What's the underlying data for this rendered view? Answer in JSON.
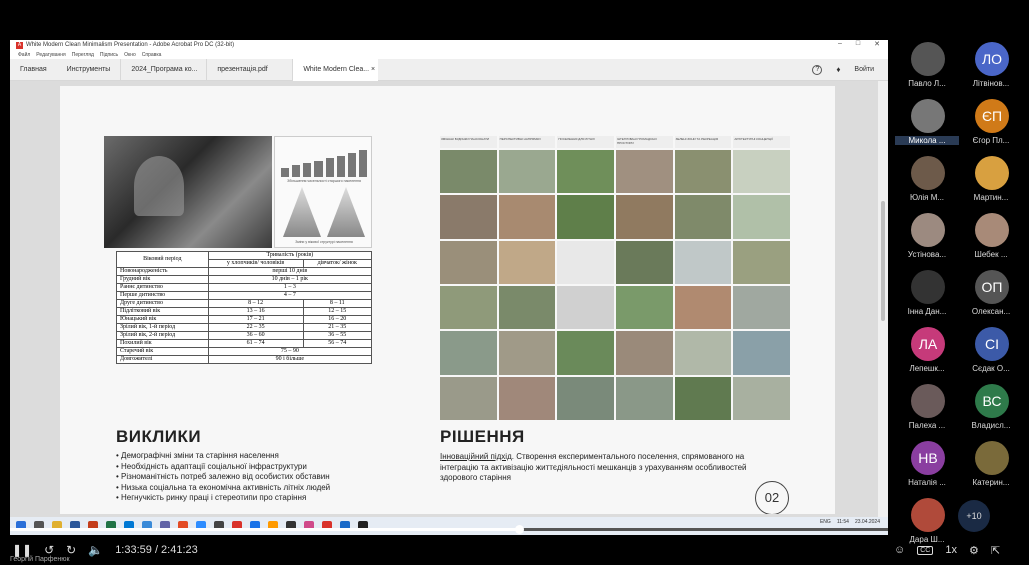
{
  "caption": "",
  "window": {
    "title": "White Modern Clean Minimalism Presentation - Adobe Acrobat Pro DC (32-bit)",
    "controls": [
      "–",
      "□",
      "✕"
    ],
    "menu": [
      "Файл",
      "Редагування",
      "Перегляд",
      "Підпись",
      "Окно",
      "Справка"
    ]
  },
  "tabs": {
    "home": "Главная",
    "tools": "Инструменты",
    "doc1": "2024_Програма ко...",
    "doc2": "презентація.pdf",
    "doc3": "White Modern Clea...",
    "close": "×",
    "signin": "Войти"
  },
  "slide": {
    "infographic_caption1": "Збільшення чисельності старшого населення",
    "infographic_caption2": "Зміни у вікової структурі населення",
    "table": {
      "head_period": "Віковий період",
      "head_duration": "Тривалість (років)",
      "head_male": "у хлопчиків/ чоловіків",
      "head_female": "дівчаток/ жінок",
      "rows": [
        {
          "period": "Новонародженість",
          "merged": "перші 10 днів"
        },
        {
          "period": "Грудний вік",
          "merged": "10 днів – 1 рік"
        },
        {
          "period": "Раннє дитинство",
          "merged": "1 – 3"
        },
        {
          "period": "Перше дитинство",
          "merged": "4 – 7"
        },
        {
          "period": "Друге дитинство",
          "male": "8 – 12",
          "female": "8 – 11"
        },
        {
          "period": "Підлітковий вік",
          "male": "13 – 16",
          "female": "12 – 15"
        },
        {
          "period": "Юнацький вік",
          "male": "17 – 21",
          "female": "16 – 20"
        },
        {
          "period": "Зрілий вік, 1-й період",
          "male": "22 – 35",
          "female": "21 – 35"
        },
        {
          "period": "Зрілий вік, 2-й період",
          "male": "36 – 60",
          "female": "36 – 55"
        },
        {
          "period": "Похилий вік",
          "male": "61 – 74",
          "female": "56 – 74"
        },
        {
          "period": "Старечий вік",
          "merged": "75 – 90"
        },
        {
          "period": "Довгожителі",
          "merged": "90 і більше"
        }
      ]
    },
    "challenges_title": "ВИКЛИКИ",
    "challenges": [
      "Демографічні зміни та старіння населення",
      "Необхідність адаптації соціальної інфраструктури",
      "Різноманітність потреб залежно від особистих обставин",
      "Низька соціальна та економічна активність літніх людей",
      "Негнучкість ринку праці і стереотипи про старіння"
    ],
    "solution_title": "РІШЕННЯ",
    "solution_lead": "Інноваційний підхід",
    "solution_text": ". Створення експериментального поселення, спрямованого на інтеграцію та активізацію життєдіяльності мешканців з урахуванням особливостей здорового старіння",
    "page_number": "02",
    "grid_headers": [
      "ЗМІШАНІ БУДИНКИ ПАНСІОНАТИ",
      "ПЕРСПЕКТИВНІ НАПРЯМКИ",
      "ПОСЕЛЕННЯ ДЛЯ ЛІТНІХ",
      "ІНТЕГРОВАНІ ГРОМАДСЬКІ ПРОСТОРИ",
      "ЗЕЛЕНІ ЗОНИ ТА РЕКРЕАЦІЯ",
      "АРХІТЕКТУРНІ КОНЦЕПЦІЇ"
    ]
  },
  "taskbar": {
    "clock": "11:54",
    "date": "23.04.2024",
    "lang": "ENG"
  },
  "participants": [
    {
      "name": "Павло Л...",
      "initials": "",
      "color": "#555"
    },
    {
      "name": "Літвінов...",
      "initials": "ЛО",
      "color": "#4a66c8"
    },
    {
      "name": "Микола ...",
      "initials": "",
      "color": "#777"
    },
    {
      "name": "Єгор Пл...",
      "initials": "ЄП",
      "color": "#d07a18"
    },
    {
      "name": "Юлія М...",
      "initials": "",
      "color": "#6d5a4a"
    },
    {
      "name": "Мартин...",
      "initials": "",
      "color": "#d8a040"
    },
    {
      "name": "Устінова...",
      "initials": "",
      "color": "#9c8a80"
    },
    {
      "name": "Шебек ...",
      "initials": "",
      "color": "#a88a78"
    },
    {
      "name": "Інна Дан...",
      "initials": "",
      "color": "#333"
    },
    {
      "name": "Олексан...",
      "initials": "ОП",
      "color": "#555"
    },
    {
      "name": "Лепешк...",
      "initials": "ЛА",
      "color": "#c63a7a"
    },
    {
      "name": "Сєдак О...",
      "initials": "СІ",
      "color": "#3c5aa8"
    },
    {
      "name": "Палеха ...",
      "initials": "",
      "color": "#6a5a5a"
    },
    {
      "name": "Владисл...",
      "initials": "ВС",
      "color": "#2e7a4a"
    },
    {
      "name": "Наталія ...",
      "initials": "НВ",
      "color": "#8a3ea0"
    },
    {
      "name": "Катерин...",
      "initials": "",
      "color": "#7a6a3a"
    },
    {
      "name": "Дара Ш...",
      "initials": "",
      "color": "#b04a3a"
    }
  ],
  "more_participants": "+10",
  "player": {
    "time": "1:33:59 / 2:41:23",
    "speed": "1x",
    "progress_fraction": 0.58,
    "speaker": "Георгій Парфенюк"
  }
}
